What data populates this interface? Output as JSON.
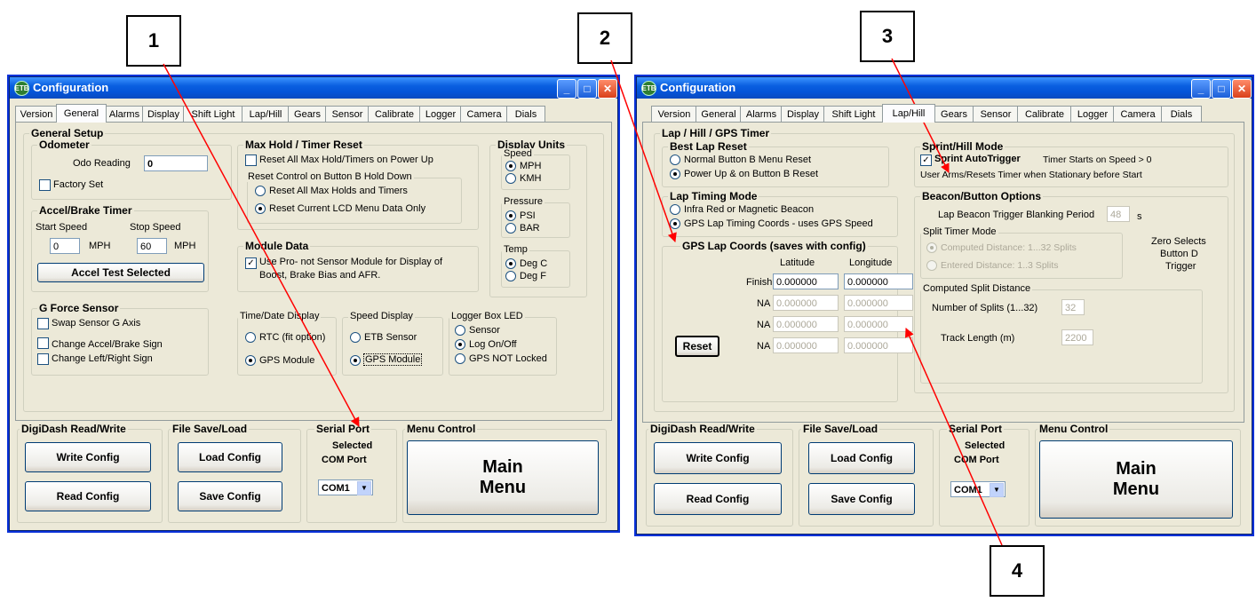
{
  "callouts": [
    "1",
    "2",
    "3",
    "4"
  ],
  "window_title": "Configuration",
  "tabs": [
    "Version",
    "General",
    "Alarms",
    "Display",
    "Shift Light",
    "Lap/Hill",
    "Gears",
    "Sensor",
    "Calibrate",
    "Logger",
    "Camera",
    "Dials"
  ],
  "left": {
    "active_tab": "General",
    "general_setup": "General Setup",
    "odometer": {
      "title": "Odometer",
      "reading_label": "Odo Reading",
      "reading_value": "0",
      "factory_set": "Factory Set"
    },
    "accel": {
      "title": "Accel/Brake Timer",
      "start_label": "Start Speed",
      "stop_label": "Stop Speed",
      "start_value": "0",
      "stop_value": "60",
      "unit": "MPH",
      "button": "Accel Test Selected"
    },
    "gforce": {
      "title": "G Force Sensor",
      "items": [
        "Swap Sensor G Axis",
        "Change Accel/Brake Sign",
        "Change Left/Right Sign"
      ]
    },
    "maxhold": {
      "title": "Max Hold / Timer Reset",
      "reset_all_power": "Reset All Max Hold/Timers on Power Up",
      "reset_control": "Reset Control on Button B Hold Down",
      "options": [
        "Reset All Max Holds and Timers",
        "Reset Current LCD Menu Data Only"
      ]
    },
    "module": {
      "title": "Module Data",
      "text1": "Use Pro- not Sensor Module for Display of",
      "text2": "Boost, Brake Bias and AFR."
    },
    "time_date": {
      "title": "Time/Date Display",
      "options": [
        "RTC (fit option)",
        "GPS Module"
      ]
    },
    "speed_display": {
      "title": "Speed Display",
      "options": [
        "ETB Sensor",
        "GPS Module"
      ]
    },
    "logger_led": {
      "title": "Logger Box LED",
      "options": [
        "Sensor",
        "Log On/Off",
        "GPS NOT Locked"
      ]
    },
    "units": {
      "title": "Display Units",
      "speed": "Speed",
      "speed_opts": [
        "MPH",
        "KMH"
      ],
      "pressure": "Pressure",
      "pressure_opts": [
        "PSI",
        "BAR"
      ],
      "temp": "Temp",
      "temp_opts": [
        "Deg C",
        "Deg F"
      ]
    }
  },
  "right": {
    "active_tab": "Lap/Hill",
    "main_title": "Lap / Hill / GPS Timer",
    "best_lap": {
      "title": "Best Lap Reset",
      "options": [
        "Normal Button B Menu Reset",
        "Power Up & on Button B Reset"
      ]
    },
    "lap_mode": {
      "title": "Lap Timing Mode",
      "options": [
        "Infra Red or Magnetic Beacon",
        "GPS Lap Timing Coords - uses GPS Speed"
      ]
    },
    "coords": {
      "title": "GPS Lap Coords (saves with config)",
      "lat": "Latitude",
      "lon": "Longitude",
      "rows": [
        {
          "label": "Finish",
          "lat": "0.000000",
          "lon": "0.000000"
        },
        {
          "label": "NA",
          "lat": "0.000000",
          "lon": "0.000000"
        },
        {
          "label": "NA",
          "lat": "0.000000",
          "lon": "0.000000"
        },
        {
          "label": "NA",
          "lat": "0.000000",
          "lon": "0.000000"
        }
      ],
      "reset": "Reset"
    },
    "sprint": {
      "title": "Sprint/Hill Mode",
      "auto": "Sprint AutoTrigger",
      "auto_note": "Timer Starts on Speed > 0",
      "note2": "User Arms/Resets Timer when Stationary before Start"
    },
    "beacon": {
      "title": "Beacon/Button Options",
      "blank_label": "Lap Beacon Trigger Blanking Period",
      "blank_value": "48",
      "blank_unit": "s",
      "split_mode": "Split Timer Mode",
      "split_opts": [
        "Computed Distance: 1...32 Splits",
        "Entered Distance: 1..3 Splits"
      ],
      "zero_note": [
        "Zero Selects",
        "Button D",
        "Trigger"
      ],
      "computed": "Computed Split Distance",
      "num_label": "Number of Splits (1...32)",
      "num_value": "32",
      "track_label": "Track Length (m)",
      "track_value": "2200"
    }
  },
  "bottom": {
    "rw_title": "DigiDash Read/Write",
    "write": "Write Config",
    "read": "Read Config",
    "file_title": "File Save/Load",
    "load": "Load Config",
    "save": "Save Config",
    "serial_title": "Serial Port",
    "selected": "Selected",
    "com_label": "COM Port",
    "com_value": "COM1",
    "menu_title": "Menu Control",
    "main1": "Main",
    "main2": "Menu"
  }
}
